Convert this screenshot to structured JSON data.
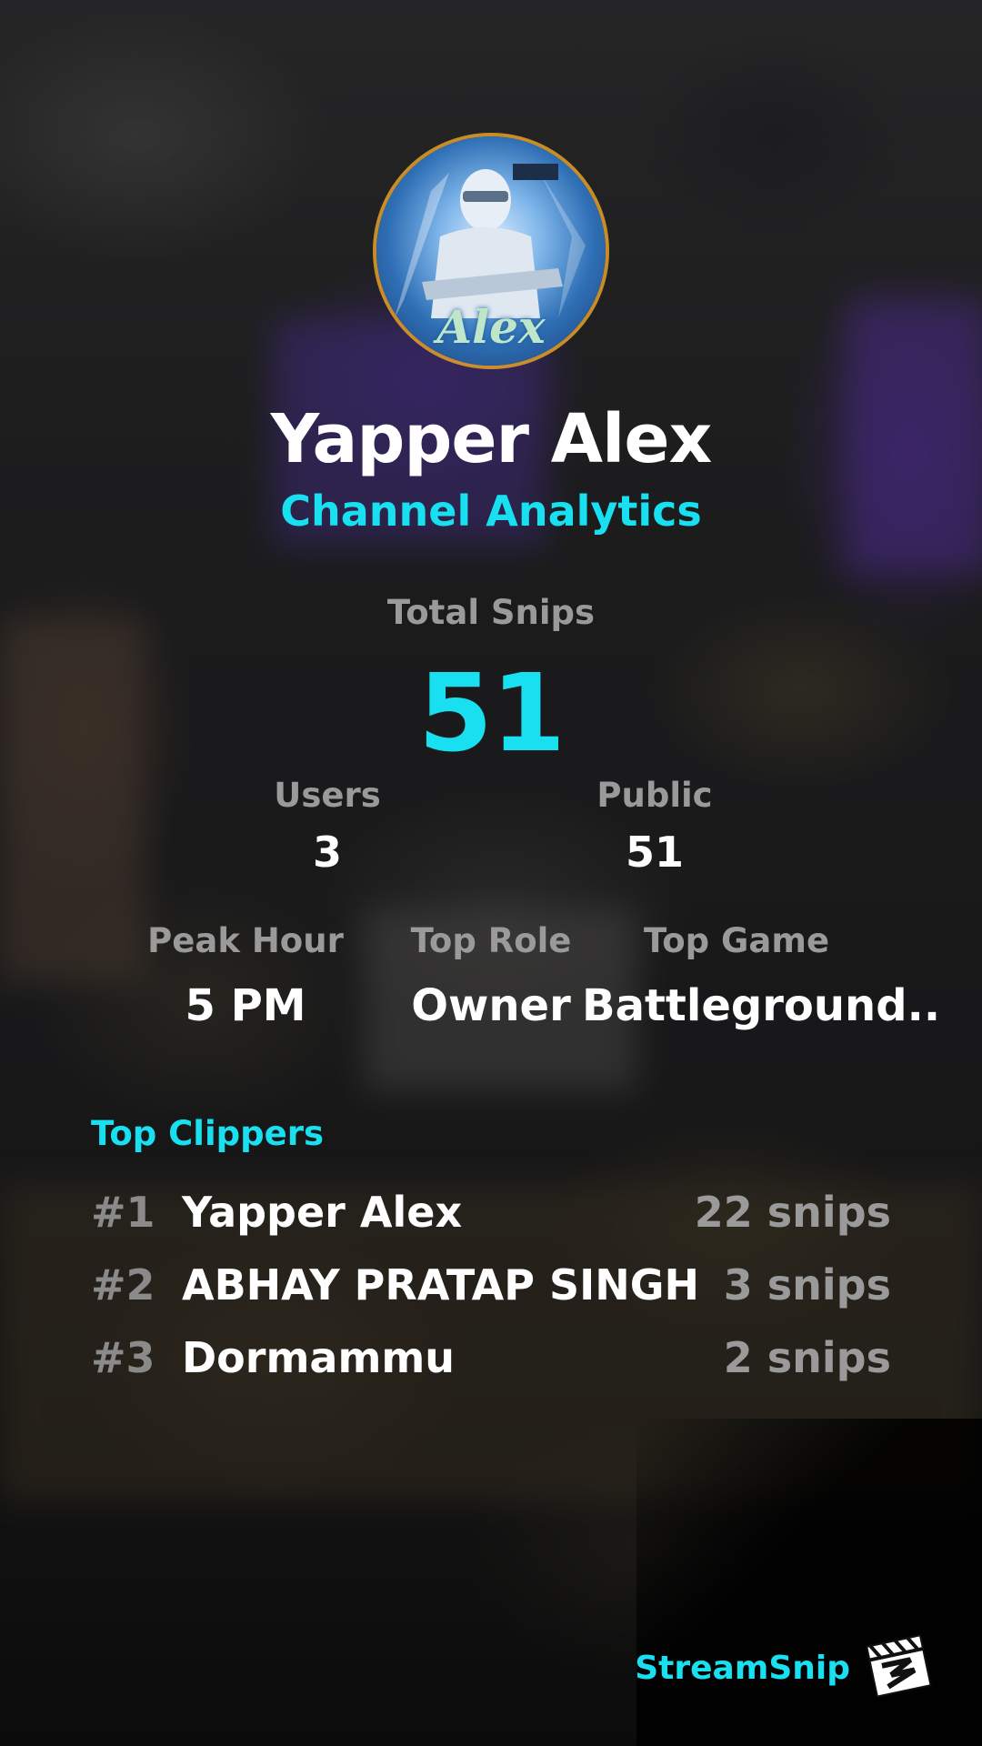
{
  "profile": {
    "name": "Yapper Alex",
    "subtitle": "Channel Analytics",
    "avatar_text": "Alex"
  },
  "totals": {
    "total_snips_label": "Total Snips",
    "total_snips_value": "51"
  },
  "stats_row1": [
    {
      "label": "Users",
      "value": "3"
    },
    {
      "label": "Public",
      "value": "51"
    }
  ],
  "stats_row2": [
    {
      "label": "Peak Hour",
      "value": "5 PM"
    },
    {
      "label": "Top Role",
      "value": "Owner"
    },
    {
      "label": "Top Game",
      "value": "Battleground.."
    }
  ],
  "top_clippers": {
    "title": "Top Clippers",
    "items": [
      {
        "rank": "#1",
        "name": "Yapper Alex",
        "snips": "22 snips"
      },
      {
        "rank": "#2",
        "name": "ABHAY PRATAP SINGH",
        "snips": "3 snips"
      },
      {
        "rank": "#3",
        "name": "Dormammu",
        "snips": "2 snips"
      }
    ]
  },
  "brand": {
    "name": "StreamSnip",
    "logo_icon": "clapperboard-icon"
  },
  "colors": {
    "accent": "#19e0f0",
    "text_primary": "#ffffff",
    "text_muted": "#9a9a9a"
  }
}
